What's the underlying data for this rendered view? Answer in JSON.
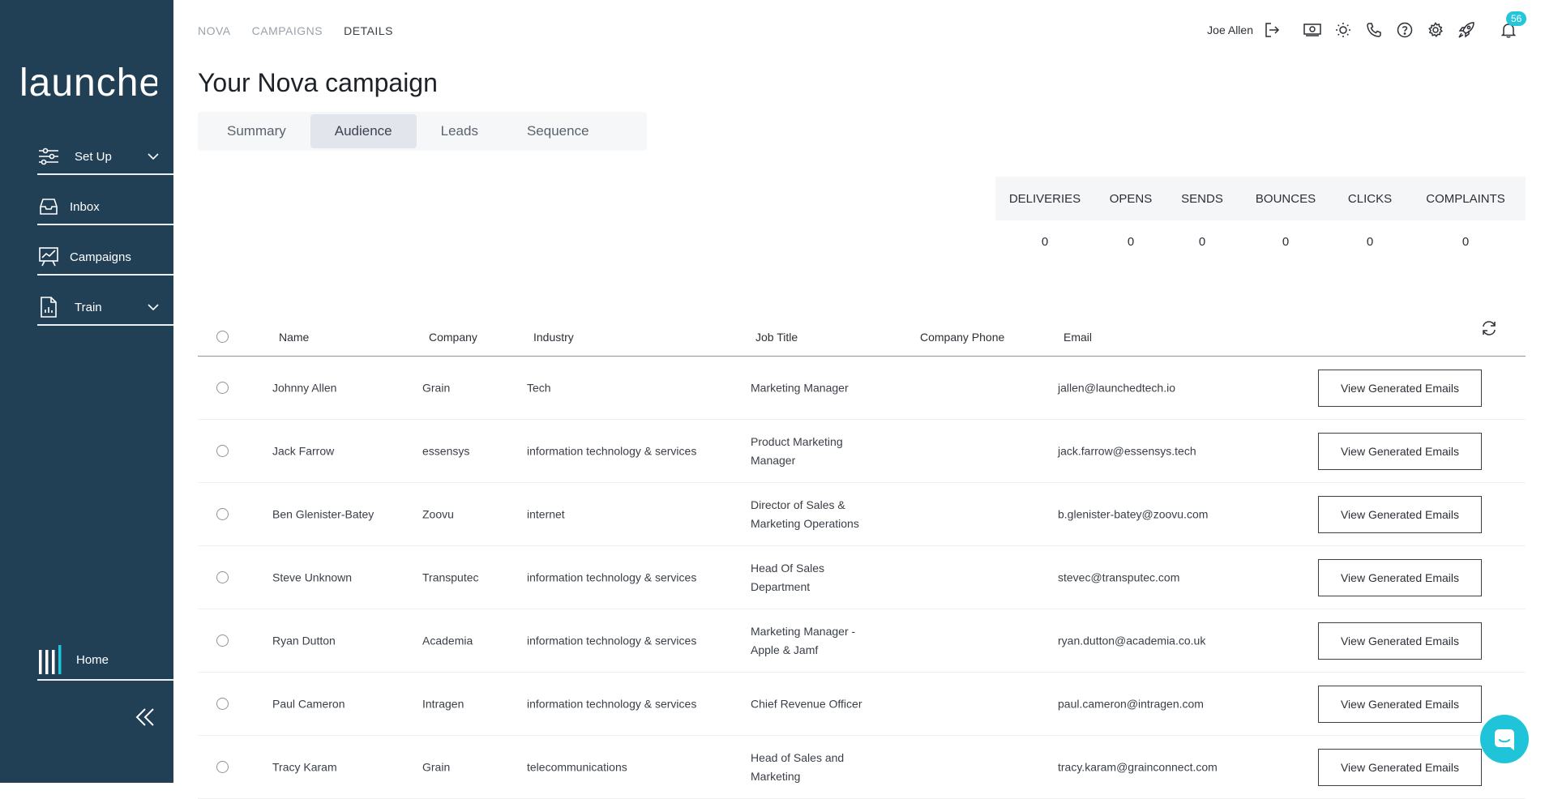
{
  "sidebar": {
    "logo_text": "launched",
    "items": [
      {
        "label": "Set Up",
        "icon": "sliders-icon"
      },
      {
        "label": "Inbox",
        "icon": "inbox-icon"
      },
      {
        "label": "Campaigns",
        "icon": "chart-board-icon"
      },
      {
        "label": "Train",
        "icon": "document-chart-icon"
      }
    ],
    "home_label": "Home"
  },
  "breadcrumb": [
    "NOVA",
    "CAMPAIGNS",
    "DETAILS"
  ],
  "page_title": "Your Nova campaign",
  "tabs": [
    "Summary",
    "Audience",
    "Leads",
    "Sequence"
  ],
  "active_tab": "Audience",
  "topbar": {
    "user_name": "Joe Allen",
    "notification_count": "56",
    "icons": [
      "logout-icon",
      "money-icon",
      "sun-icon",
      "phone-icon",
      "help-icon",
      "gear-icon",
      "rocket-icon",
      "bell-icon"
    ]
  },
  "stats": {
    "headers": [
      "DELIVERIES",
      "OPENS",
      "SENDS",
      "BOUNCES",
      "CLICKS",
      "COMPLAINTS"
    ],
    "values": [
      "0",
      "0",
      "0",
      "0",
      "0",
      "0"
    ]
  },
  "table": {
    "columns": [
      "Name",
      "Company",
      "Industry",
      "Job Title",
      "Company Phone",
      "Email"
    ],
    "button_label": "View Generated Emails",
    "rows": [
      {
        "name": "Johnny Allen",
        "company": "Grain",
        "industry": "Tech",
        "job_title": "Marketing Manager",
        "email": "jallen@launchedtech.io"
      },
      {
        "name": "Jack Farrow",
        "company": "essensys",
        "industry": "information technology & services",
        "job_title": "Product Marketing Manager",
        "email": "jack.farrow@essensys.tech"
      },
      {
        "name": "Ben Glenister-Batey",
        "company": "Zoovu",
        "industry": "internet",
        "job_title": "Director of Sales & Marketing Operations",
        "email": "b.glenister-batey@zoovu.com"
      },
      {
        "name": "Steve Unknown",
        "company": "Transputec",
        "industry": "information technology & services",
        "job_title": "Head Of Sales Department",
        "email": "stevec@transputec.com"
      },
      {
        "name": "Ryan Dutton",
        "company": "Academia",
        "industry": "information technology & services",
        "job_title": "Marketing Manager - Apple & Jamf",
        "email": "ryan.dutton@academia.co.uk"
      },
      {
        "name": "Paul Cameron",
        "company": "Intragen",
        "industry": "information technology & services",
        "job_title": "Chief Revenue Officer",
        "email": "paul.cameron@intragen.com"
      },
      {
        "name": "Tracy Karam",
        "company": "Grain",
        "industry": "telecommunications",
        "job_title": "Head of Sales and Marketing",
        "email": "tracy.karam@grainconnect.com"
      }
    ]
  },
  "colors": {
    "sidebar_bg": "#213f55",
    "accent": "#1fc4d8"
  }
}
